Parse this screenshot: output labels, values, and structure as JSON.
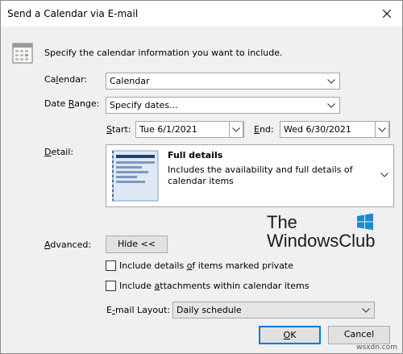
{
  "window": {
    "title": "Send a Calendar via E-mail"
  },
  "intro": {
    "text": "Specify the calendar information you want to include."
  },
  "calendar": {
    "label_pre": "Ca",
    "label_u": "l",
    "label_post": "endar:",
    "value": "Calendar"
  },
  "date_range": {
    "label_pre": "Date ",
    "label_u": "R",
    "label_post": "ange:",
    "value": "Specify dates..."
  },
  "start": {
    "label_pre": "",
    "label_u": "S",
    "label_post": "tart:",
    "value": "Tue 6/1/2021"
  },
  "end": {
    "label_pre": "",
    "label_u": "E",
    "label_post": "nd:",
    "value": "Wed 6/30/2021"
  },
  "detail": {
    "label_pre": "",
    "label_u": "D",
    "label_post": "etail:",
    "title": "Full details",
    "description": "Includes the availability and full details of calendar items"
  },
  "advanced": {
    "label_pre": "",
    "label_u": "A",
    "label_post": "dvanced:",
    "button": "Hide <<"
  },
  "options": {
    "private": {
      "pre": "Include details ",
      "u": "o",
      "post": "f items marked private",
      "checked": false
    },
    "attachments": {
      "pre": "Include ",
      "u": "a",
      "post": "ttachments within calendar items",
      "checked": false
    }
  },
  "layout": {
    "label_pre": "E",
    "label_u": "-",
    "label_post": "mail Layout:",
    "value": "Daily schedule"
  },
  "buttons": {
    "ok_u": "O",
    "ok_post": "K",
    "cancel": "Cancel"
  },
  "logo": {
    "line1": "The",
    "line2": "WindowsClub"
  },
  "watermark": "wsxdn.com",
  "colors": {
    "accent": "#0078d7",
    "dialog_bg": "#f0f0f0",
    "doc_blue": "#1f3f7a"
  },
  "icons": {
    "close": "close-icon",
    "calendar": "calendar-icon",
    "dropdown": "chevron-down-icon",
    "detail": "document-preview-icon",
    "logo": "windows-flag-icon"
  }
}
